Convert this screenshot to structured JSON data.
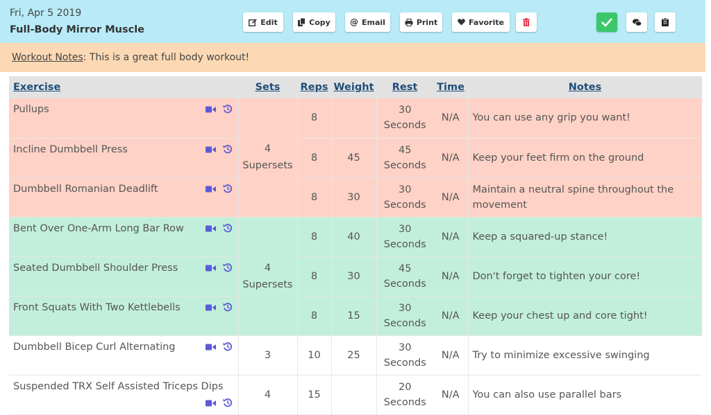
{
  "header": {
    "date": "Fri, Apr 5 2019",
    "title": "Full-Body Mirror Muscle",
    "buttons": {
      "edit": "Edit",
      "copy": "Copy",
      "email": "Email",
      "print": "Print",
      "favorite": "Favorite"
    },
    "icons": [
      "edit-icon",
      "copy-icon",
      "email-icon",
      "print-icon",
      "heart-icon",
      "trash-icon",
      "check-icon",
      "comments-icon",
      "clipboard-icon"
    ],
    "colors": {
      "header_bg": "#b8ebf7",
      "check_bg": "#3cc76b",
      "trash": "#e8334a"
    }
  },
  "notes_bar": {
    "label": "Workout Notes",
    "text": ": This is a great full body workout!"
  },
  "table": {
    "headers": {
      "exercise": "Exercise",
      "sets": "Sets",
      "reps": "Reps",
      "weight": "Weight",
      "rest": "Rest",
      "time": "Time",
      "notes": "Notes"
    },
    "groups": [
      {
        "sets_num": "4",
        "sets_label": "Supersets",
        "color": "#fed2c6"
      },
      {
        "sets_num": "4",
        "sets_label": "Supersets",
        "color": "#c2efdb"
      }
    ],
    "rows": [
      {
        "exercise": "Pullups",
        "sets": "",
        "reps": "8",
        "weight": "",
        "rest_num": "30",
        "rest_unit": "Seconds",
        "time": "N/A",
        "notes": "You can use any grip you want!"
      },
      {
        "exercise": "Incline Dumbbell Press",
        "sets": "",
        "reps": "8",
        "weight": "45",
        "rest_num": "45",
        "rest_unit": "Seconds",
        "time": "N/A",
        "notes": "Keep your feet firm on the ground"
      },
      {
        "exercise": "Dumbbell Romanian Deadlift",
        "sets": "",
        "reps": "8",
        "weight": "30",
        "rest_num": "30",
        "rest_unit": "Seconds",
        "time": "N/A",
        "notes": "Maintain a neutral spine throughout the movement"
      },
      {
        "exercise": "Bent Over One-Arm Long Bar Row",
        "sets": "",
        "reps": "8",
        "weight": "40",
        "rest_num": "30",
        "rest_unit": "Seconds",
        "time": "N/A",
        "notes": "Keep a squared-up stance!"
      },
      {
        "exercise": "Seated Dumbbell Shoulder Press",
        "sets": "",
        "reps": "8",
        "weight": "30",
        "rest_num": "45",
        "rest_unit": "Seconds",
        "time": "N/A",
        "notes": "Don't forget to tighten your core!"
      },
      {
        "exercise": "Front Squats With Two Kettlebells",
        "sets": "",
        "reps": "8",
        "weight": "15",
        "rest_num": "30",
        "rest_unit": "Seconds",
        "time": "N/A",
        "notes": "Keep your chest up and core tight!"
      },
      {
        "exercise": "Dumbbell Bicep Curl Alternating",
        "sets": "3",
        "reps": "10",
        "weight": "25",
        "rest_num": "30",
        "rest_unit": "Seconds",
        "time": "N/A",
        "notes": "Try to minimize excessive swinging"
      },
      {
        "exercise": "Suspended TRX Self Assisted Triceps Dips",
        "sets": "4",
        "reps": "15",
        "weight": "",
        "rest_num": "20",
        "rest_unit": "Seconds",
        "time": "N/A",
        "notes": "You can also use parallel bars"
      }
    ],
    "row_icons": [
      "video-icon",
      "history-icon"
    ],
    "colors": {
      "header_text": "#1f4e79",
      "icon": "#5b5bd6"
    }
  }
}
